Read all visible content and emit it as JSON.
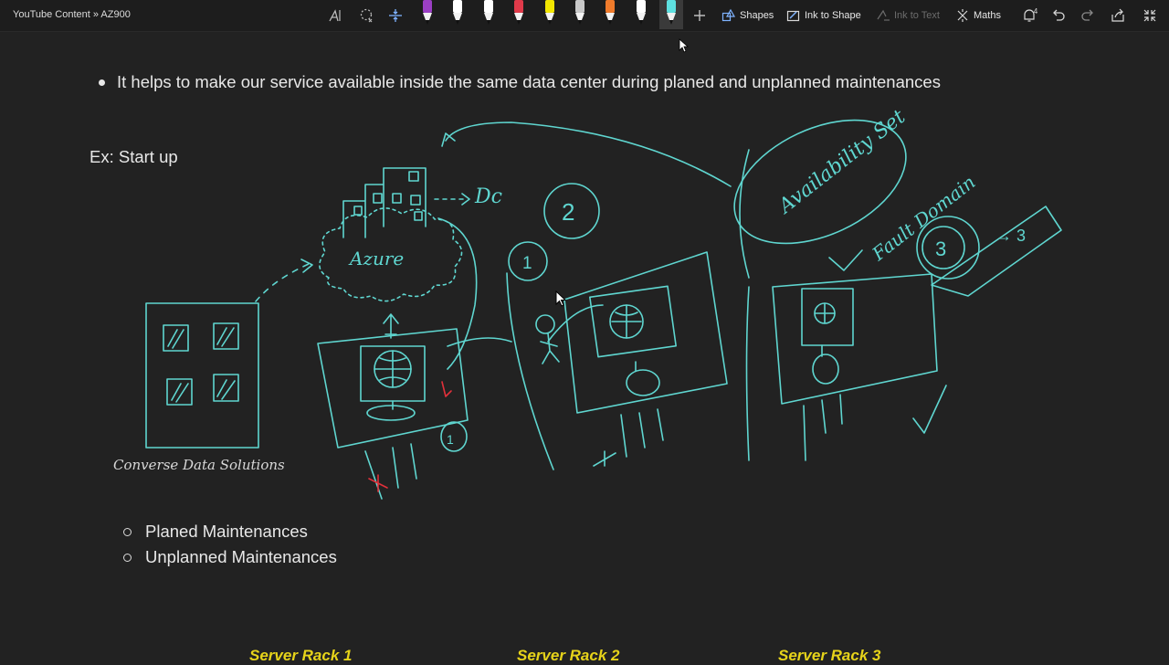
{
  "window": {
    "breadcrumb": "YouTube Content » AZ900"
  },
  "toolbar": {
    "pens": [
      {
        "name": "pen-purple",
        "color": "#9b3fc4"
      },
      {
        "name": "pen-white-1",
        "color": "#ffffff"
      },
      {
        "name": "pen-white-2",
        "color": "#ffffff"
      },
      {
        "name": "pen-red",
        "color": "#e03a4a"
      },
      {
        "name": "highlighter-yellow",
        "color": "#f2e600"
      },
      {
        "name": "pen-gray",
        "color": "#c8c8c8"
      },
      {
        "name": "pen-multi",
        "color": "#f07b2b"
      },
      {
        "name": "pen-white-3",
        "color": "#ffffff"
      },
      {
        "name": "pen-cyan",
        "color": "#5ee0e0"
      }
    ],
    "shapes_label": "Shapes",
    "ink_to_shape_label": "Ink to Shape",
    "ink_to_text_label": "Ink to Text",
    "maths_label": "Maths",
    "notification_count": "4"
  },
  "page": {
    "bullet": "It helps to make our service available inside the same data center during planed and unplanned maintenances",
    "example": "Ex: Start up",
    "company": "Converse Data Solutions",
    "sub_bullets": [
      "Planed Maintenances",
      "Unplanned Maintenances"
    ],
    "rack_labels": [
      "Server Rack 1",
      "Server Rack 2",
      "Server Rack 3"
    ]
  },
  "ink": {
    "color": "#5fd6d0",
    "accent": "#e0303a",
    "annotations": [
      "Azure",
      "Dc",
      "1",
      "2",
      "3",
      "Availability Set",
      "Fault Domain",
      "→ 3",
      "1"
    ]
  }
}
